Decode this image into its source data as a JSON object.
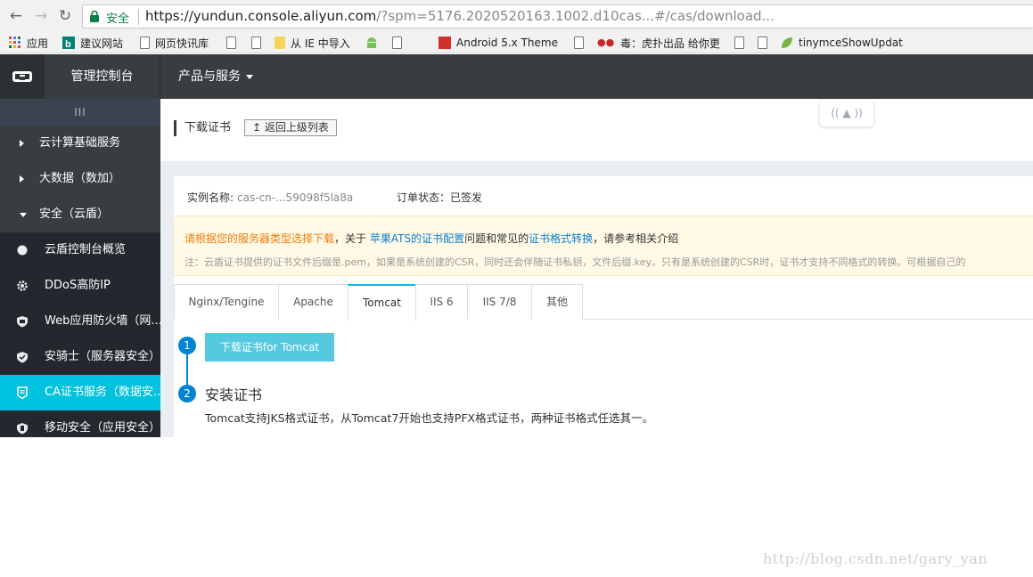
{
  "browser": {
    "secure_label": "安全",
    "url_host": "https://yundun.console.aliyun.com",
    "url_rest": "/?spm=5176.2020520163.1002.d10cas...#/cas/download...",
    "bookmarks": [
      {
        "label": "应用",
        "icon": "apps-grid-icon"
      },
      {
        "label": "建议网站",
        "icon": "bing-icon"
      },
      {
        "label": "网页快讯库",
        "icon": "page-icon"
      },
      {
        "label": "",
        "icon": "page-icon"
      },
      {
        "label": "",
        "icon": "page-icon"
      },
      {
        "label": "从 IE 中导入",
        "icon": "folder-icon"
      },
      {
        "label": "",
        "icon": "android-icon"
      },
      {
        "label": "",
        "icon": "page-icon"
      },
      {
        "label": "Android 5.x Theme",
        "icon": "red-square-icon"
      },
      {
        "label": "",
        "icon": "page-icon"
      },
      {
        "label": "毒：虎扑出品 给你更",
        "icon": "hupu-icon"
      },
      {
        "label": "",
        "icon": "page-icon"
      },
      {
        "label": "",
        "icon": "page-icon"
      },
      {
        "label": "tinymceShowUpdat",
        "icon": "leaf-icon"
      }
    ]
  },
  "topbar": {
    "console_title": "管理控制台",
    "products_label": "产品与服务"
  },
  "sidebar": {
    "toggle_label": "III",
    "groups": [
      {
        "label": "云计算基础服务",
        "expanded": false
      },
      {
        "label": "大数据（数加）",
        "expanded": false
      },
      {
        "label": "安全（云盾）",
        "expanded": true
      }
    ],
    "items": [
      {
        "label": "云盾控制台概览",
        "icon": "dot-icon",
        "active": false
      },
      {
        "label": "DDoS高防IP",
        "icon": "gear-icon",
        "active": false
      },
      {
        "label": "Web应用防火墙（网...",
        "icon": "shield-icon",
        "active": false
      },
      {
        "label": "安骑士（服务器安全）",
        "icon": "knight-shield-icon",
        "active": false
      },
      {
        "label": "CA证书服务（数据安...",
        "icon": "certificate-icon",
        "active": true
      },
      {
        "label": "移动安全（应用安全）",
        "icon": "mobile-shield-icon",
        "active": false
      }
    ]
  },
  "page": {
    "title": "下载证书",
    "back_label": "返回上级列表",
    "instance_label": "实例名称:",
    "instance_value": "cas-cn-...59098f5la8a",
    "order_status": "订单状态：已签发",
    "notice": {
      "warn_text": "请根据您的服务器类型选择下载",
      "text_a": "，关于",
      "link_ats": "苹果ATS的证书配置",
      "text_b": "问题和常见的",
      "link_format": "证书格式转换",
      "text_c": "，请参考相关介绍",
      "note": "注：云盾证书提供的证书文件后缀是.pem，如果是系统创建的CSR，同时还会伴随证书私钥，文件后缀.key。只有是系统创建的CSR时，证书才支持不同格式的转换。可根据自己的"
    },
    "tabs": [
      "Nginx/Tengine",
      "Apache",
      "Tomcat",
      "IIS 6",
      "IIS 7/8",
      "其他"
    ],
    "active_tab": "Tomcat",
    "steps": [
      {
        "number": "1",
        "button_label": "下载证书for Tomcat"
      },
      {
        "number": "2",
        "title": "安装证书",
        "description": "Tomcat支持JKS格式证书，从Tomcat7开始也支持PFX格式证书，两种证书格式任选其一。"
      }
    ]
  },
  "watermark": "http://blog.csdn.net/gary_yan",
  "colors": {
    "topbar_bg": "#373d41",
    "sidebar_bg": "#293038",
    "active_item": "#00c1de",
    "step_blue": "#0083d3",
    "download_button": "#55c9e0",
    "warn_orange": "#f07c0e",
    "link_blue": "#0a7fd3"
  }
}
